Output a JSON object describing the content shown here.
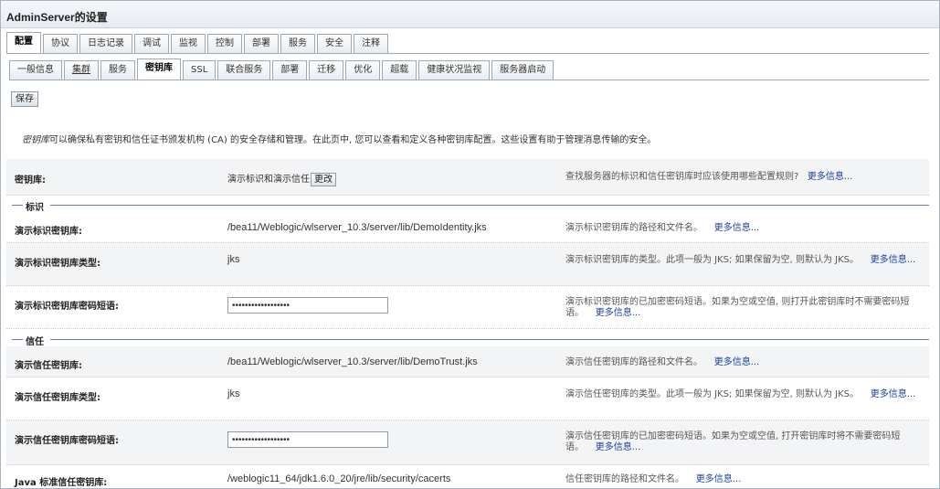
{
  "window": {
    "title": "AdminServer的设置"
  },
  "primary_tabs": [
    {
      "label": "配置",
      "active": true
    },
    {
      "label": "协议"
    },
    {
      "label": "日志记录"
    },
    {
      "label": "调试"
    },
    {
      "label": "监视"
    },
    {
      "label": "控制"
    },
    {
      "label": "部署"
    },
    {
      "label": "服务"
    },
    {
      "label": "安全"
    },
    {
      "label": "注释"
    }
  ],
  "secondary_tabs": [
    {
      "label": "一般信息"
    },
    {
      "label": "集群"
    },
    {
      "label": "服务"
    },
    {
      "label": "密钥库",
      "active": true
    },
    {
      "label": "SSL"
    },
    {
      "label": "联合服务"
    },
    {
      "label": "部署"
    },
    {
      "label": "迁移"
    },
    {
      "label": "优化"
    },
    {
      "label": "超载"
    },
    {
      "label": "健康状况监视"
    },
    {
      "label": "服务器启动"
    }
  ],
  "toolbar": {
    "save_label": "保存"
  },
  "description": {
    "keyword": "密钥库",
    "text": "可以确保私有密钥和信任证书颁发机构 (CA) 的安全存储和管理。在此页中, 您可以查看和定义各种密钥库配置。这些设置有助于管理消息传输的安全。"
  },
  "keystores": {
    "label": "密钥库:",
    "value": "演示标识和演示信任",
    "change_label": "更改",
    "help": "查找服务器的标识和信任密钥库时应该使用哪些配置规则?",
    "more": "更多信息..."
  },
  "sections": {
    "identity": "标识",
    "trust": "信任"
  },
  "rows": {
    "demo_identity_keystore": {
      "label": "演示标识密钥库:",
      "value": "/bea11/Weblogic/wlserver_10.3/server/lib/DemoIdentity.jks",
      "help": "演示标识密钥库的路径和文件名。",
      "more": "更多信息..."
    },
    "demo_identity_type": {
      "label": "演示标识密钥库类型:",
      "value": "jks",
      "help": "演示标识密钥库的类型。此项一般为 JKS; 如果保留为空, 则默认为 JKS。",
      "more": "更多信息..."
    },
    "demo_identity_passphrase": {
      "label": "演示标识密钥库密码短语:",
      "value": "••••••••••••••••••",
      "help": "演示标识密钥库的已加密密码短语。如果为空或空值, 则打开此密钥库时不需要密码短语。",
      "more": "更多信息..."
    },
    "demo_trust_keystore": {
      "label": "演示信任密钥库:",
      "value": "/bea11/Weblogic/wlserver_10.3/server/lib/DemoTrust.jks",
      "help": "演示信任密钥库的路径和文件名。",
      "more": "更多信息..."
    },
    "demo_trust_type": {
      "label": "演示信任密钥库类型:",
      "value": "jks",
      "help": "演示信任密钥库的类型。此项一般为 JKS; 如果保留为空, 则默认为 JKS。",
      "more": "更多信息..."
    },
    "demo_trust_passphrase": {
      "label": "演示信任密钥库密码短语:",
      "value": "••••••••••••••••••",
      "help": "演示信任密钥库的已加密密码短语。如果为空或空值, 打开密钥库时将不需要密码短语。",
      "more": "更多信息..."
    },
    "java_std_trust": {
      "label": "Java 标准信任密钥库:",
      "value": "/weblogic11_64/jdk1.6.0_20/jre/lib/security/cacerts",
      "help": "信任密钥库的路径和文件名。",
      "more": "更多信息..."
    }
  }
}
